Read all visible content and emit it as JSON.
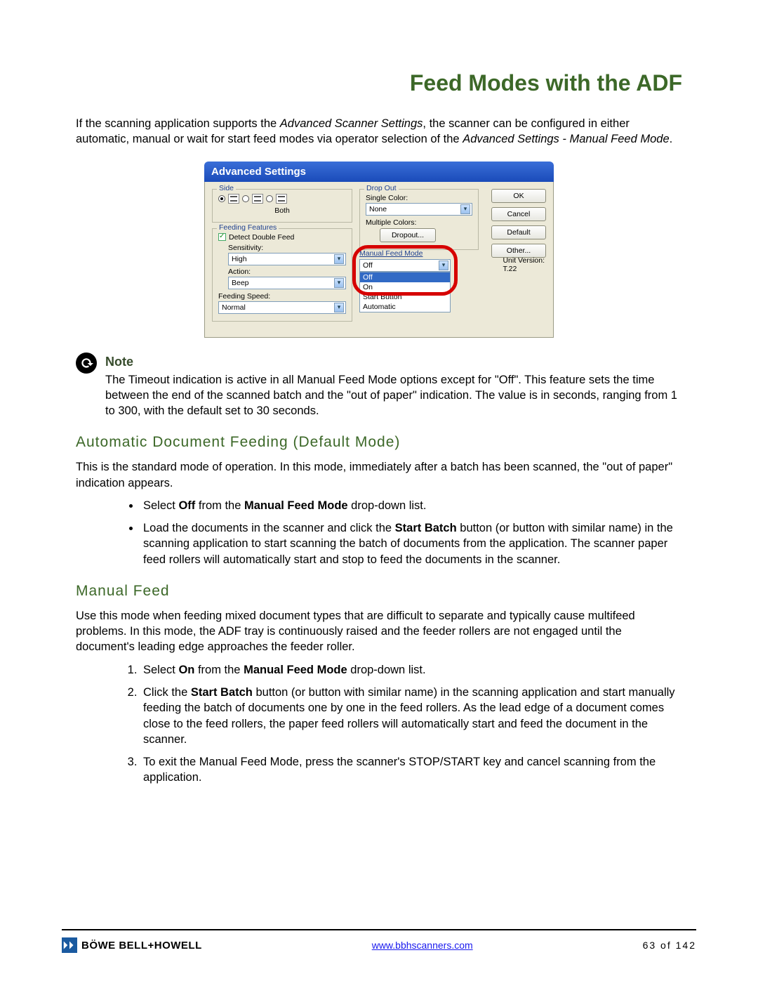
{
  "page": {
    "title": "Feed Modes with the ADF",
    "intro_a": "If the scanning application supports the ",
    "intro_em1": "Advanced Scanner Settings",
    "intro_b": ", the scanner can be configured in either automatic, manual or wait for start feed modes via operator selection of the ",
    "intro_em2": "Advanced Settings - Manual Feed Mode",
    "intro_c": "."
  },
  "dialog": {
    "title": "Advanced Settings",
    "side_legend": "Side",
    "both_label": "Both",
    "feeding_legend": "Feeding Features",
    "detect_double": "Detect Double Feed",
    "sensitivity_label": "Sensitivity:",
    "sensitivity_value": "High",
    "action_label": "Action:",
    "action_value": "Beep",
    "feeding_speed_label": "Feeding Speed:",
    "feeding_speed_value": "Normal",
    "dropout_legend": "Drop Out",
    "single_color_label": "Single Color:",
    "single_color_value": "None",
    "multiple_colors_label": "Multiple Colors:",
    "dropout_btn": "Dropout...",
    "mfm_label": "Manual Feed Mode",
    "mfm_selected": "Off",
    "mfm_options": [
      "Off",
      "On",
      "Start Button",
      "Automatic"
    ],
    "unit_version_label": "Unit Version:",
    "unit_version_value": "T.22",
    "buttons": {
      "ok": "OK",
      "cancel": "Cancel",
      "default": "Default",
      "other": "Other..."
    }
  },
  "note": {
    "heading": "Note",
    "body": "The Timeout indication is active in all Manual Feed Mode options except for \"Off\". This feature sets the time between the end of the scanned batch and the \"out of paper\" indication. The value is in seconds, ranging from 1 to 300, with the default set to 30 seconds."
  },
  "auto": {
    "heading": "Automatic Document Feeding (Default Mode)",
    "p": "This is the standard mode of operation. In this mode, immediately after a batch has been scanned, the \"out of paper\" indication appears.",
    "b1_a": "Select ",
    "b1_bold1": "Off",
    "b1_b": " from the ",
    "b1_bold2": "Manual Feed Mode",
    "b1_c": " drop-down list.",
    "b2_a": "Load the documents in the scanner and click the ",
    "b2_bold": "Start Batch",
    "b2_b": " button (or button with similar name) in the scanning application to start scanning the batch of documents from the application. The scanner paper feed rollers will automatically start and stop to feed the documents in the scanner."
  },
  "manual": {
    "heading": "Manual Feed",
    "p": "Use this mode when feeding mixed document types that are difficult to separate and typically cause multifeed problems. In this mode, the ADF tray is continuously raised and the feeder rollers are not engaged until the document's leading edge approaches the feeder roller.",
    "s1_a": "Select ",
    "s1_bold1": "On",
    "s1_b": " from the ",
    "s1_bold2": "Manual Feed Mode",
    "s1_c": " drop-down list.",
    "s2_a": "Click the ",
    "s2_bold": "Start Batch",
    "s2_b": " button (or button with similar name) in the scanning application and start manually feeding the batch of documents one by one in the feed rollers. As the lead edge of a document comes close to the feed rollers, the paper feed rollers will automatically start and feed the document in the scanner.",
    "s3": "To exit the Manual Feed Mode, press the scanner's STOP/START key and cancel scanning from the application."
  },
  "footer": {
    "brand_a": "BÖWE BELL",
    "brand_plus": "+",
    "brand_b": "HOWELL",
    "link": "www.bbhscanners.com",
    "page": "63 of 142"
  }
}
